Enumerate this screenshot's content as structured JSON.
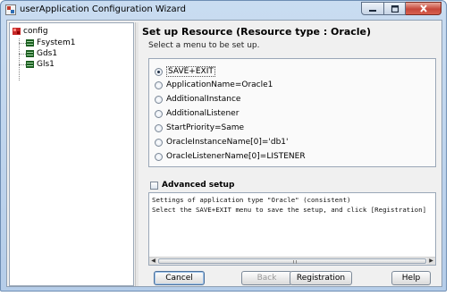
{
  "window": {
    "title": "userApplication Configuration Wizard"
  },
  "tree": {
    "root": "config",
    "children": [
      "Fsystem1",
      "Gds1",
      "Gls1"
    ]
  },
  "header": {
    "title": "Set up Resource (Resource type : Oracle)",
    "subtitle": "Select a menu to be set up."
  },
  "options": [
    {
      "label": "SAVE+EXIT",
      "selected": true
    },
    {
      "label": "ApplicationName=Oracle1",
      "selected": false
    },
    {
      "label": "AdditionalInstance",
      "selected": false
    },
    {
      "label": "AdditionalListener",
      "selected": false
    },
    {
      "label": "StartPriority=Same",
      "selected": false
    },
    {
      "label": "OracleInstanceName[0]='db1'",
      "selected": false
    },
    {
      "label": "OracleListenerName[0]=LISTENER",
      "selected": false
    }
  ],
  "advanced": {
    "label": "Advanced setup",
    "checked": false
  },
  "messages": [
    "Settings of application type \"Oracle\" (consistent)",
    "Select the SAVE+EXIT menu to save the setup, and click [Registration]"
  ],
  "buttons": {
    "cancel": "Cancel",
    "back": "Back",
    "registration": "Registration",
    "help": "Help"
  },
  "colors": {
    "title_bar": "#c9dcf1",
    "close_button": "#c6473a"
  }
}
